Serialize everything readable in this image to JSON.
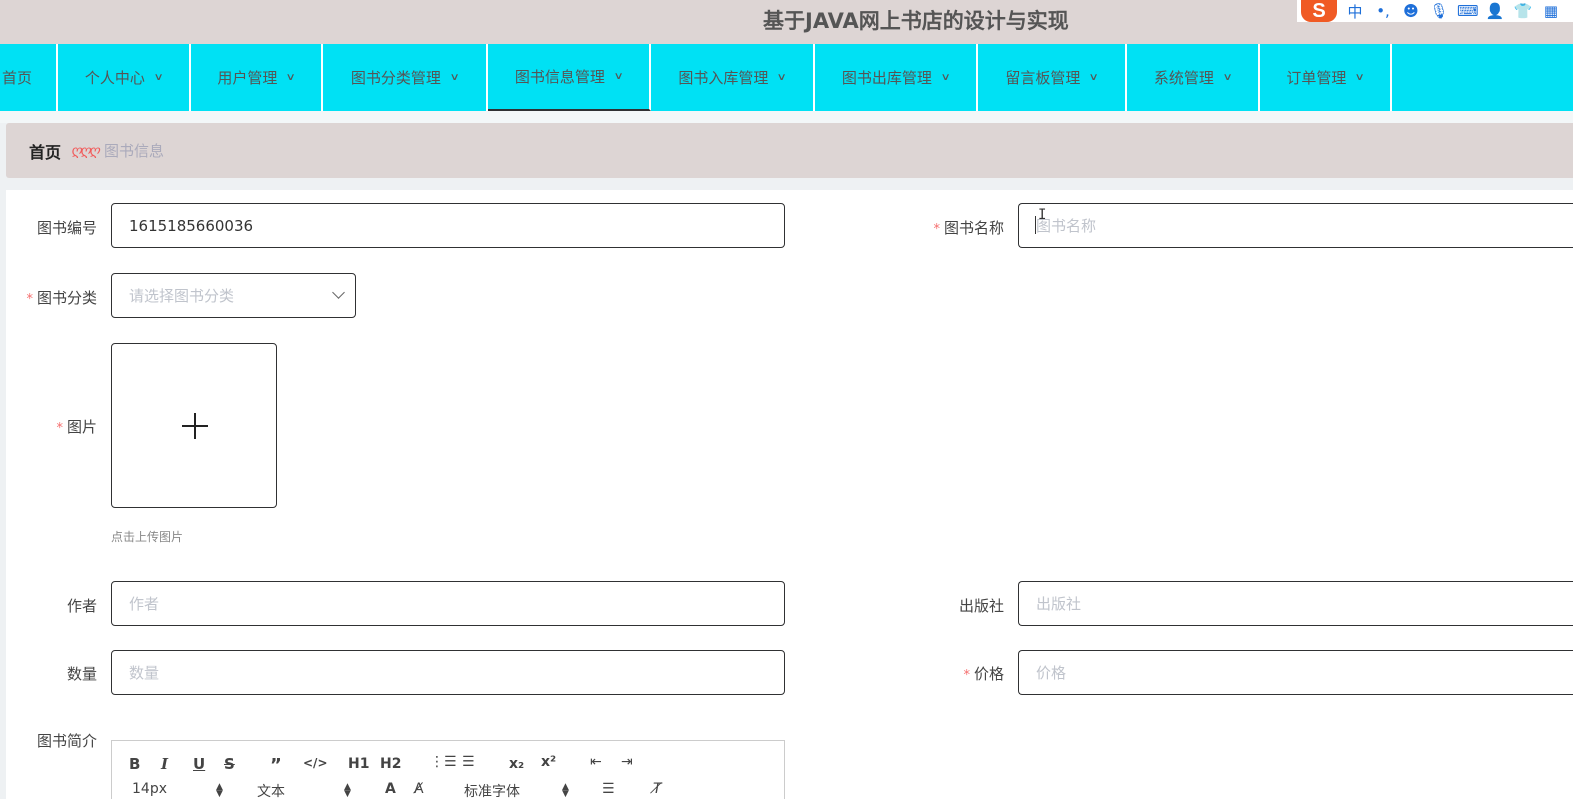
{
  "app": {
    "title": "基于JAVA网上书店的设计与实现"
  },
  "ime_toolbar": {
    "logo": "S",
    "mode": "中",
    "punct": "•,",
    "icons": [
      "emoji-icon",
      "microphone-icon",
      "keyboard-icon",
      "user-icon",
      "shirt-icon",
      "grid-icon"
    ]
  },
  "nav": {
    "items": [
      {
        "label": "首页"
      },
      {
        "label": "个人中心"
      },
      {
        "label": "用户管理"
      },
      {
        "label": "图书分类管理"
      },
      {
        "label": "图书信息管理"
      },
      {
        "label": "图书入库管理"
      },
      {
        "label": "图书出库管理"
      },
      {
        "label": "留言板管理"
      },
      {
        "label": "系统管理"
      },
      {
        "label": "订单管理"
      }
    ],
    "active_index": 4,
    "background": "#00e1f4"
  },
  "breadcrumb": {
    "home": "首页",
    "separator": "ღღღ",
    "current": "图书信息"
  },
  "form": {
    "book_no": {
      "label": "图书编号",
      "value": "1615185660036"
    },
    "book_name": {
      "label": "图书名称",
      "placeholder": "图书名称"
    },
    "category": {
      "label": "图书分类",
      "placeholder": "请选择图书分类"
    },
    "image": {
      "label": "图片",
      "tip": "点击上传图片"
    },
    "author": {
      "label": "作者",
      "placeholder": "作者"
    },
    "publisher": {
      "label": "出版社",
      "placeholder": "出版社"
    },
    "quantity": {
      "label": "数量",
      "placeholder": "数量"
    },
    "price": {
      "label": "价格",
      "placeholder": "价格"
    },
    "intro": {
      "label": "图书简介"
    },
    "required_mark": "*"
  },
  "editor": {
    "row1": [
      "B",
      "I",
      "U",
      "S",
      "”",
      "</>",
      "H1",
      "H2",
      "list-ordered",
      "list-bullet",
      "x₂",
      "x²",
      "outdent",
      "indent"
    ],
    "size": "14px",
    "block": "文本",
    "font": "标准字体"
  }
}
